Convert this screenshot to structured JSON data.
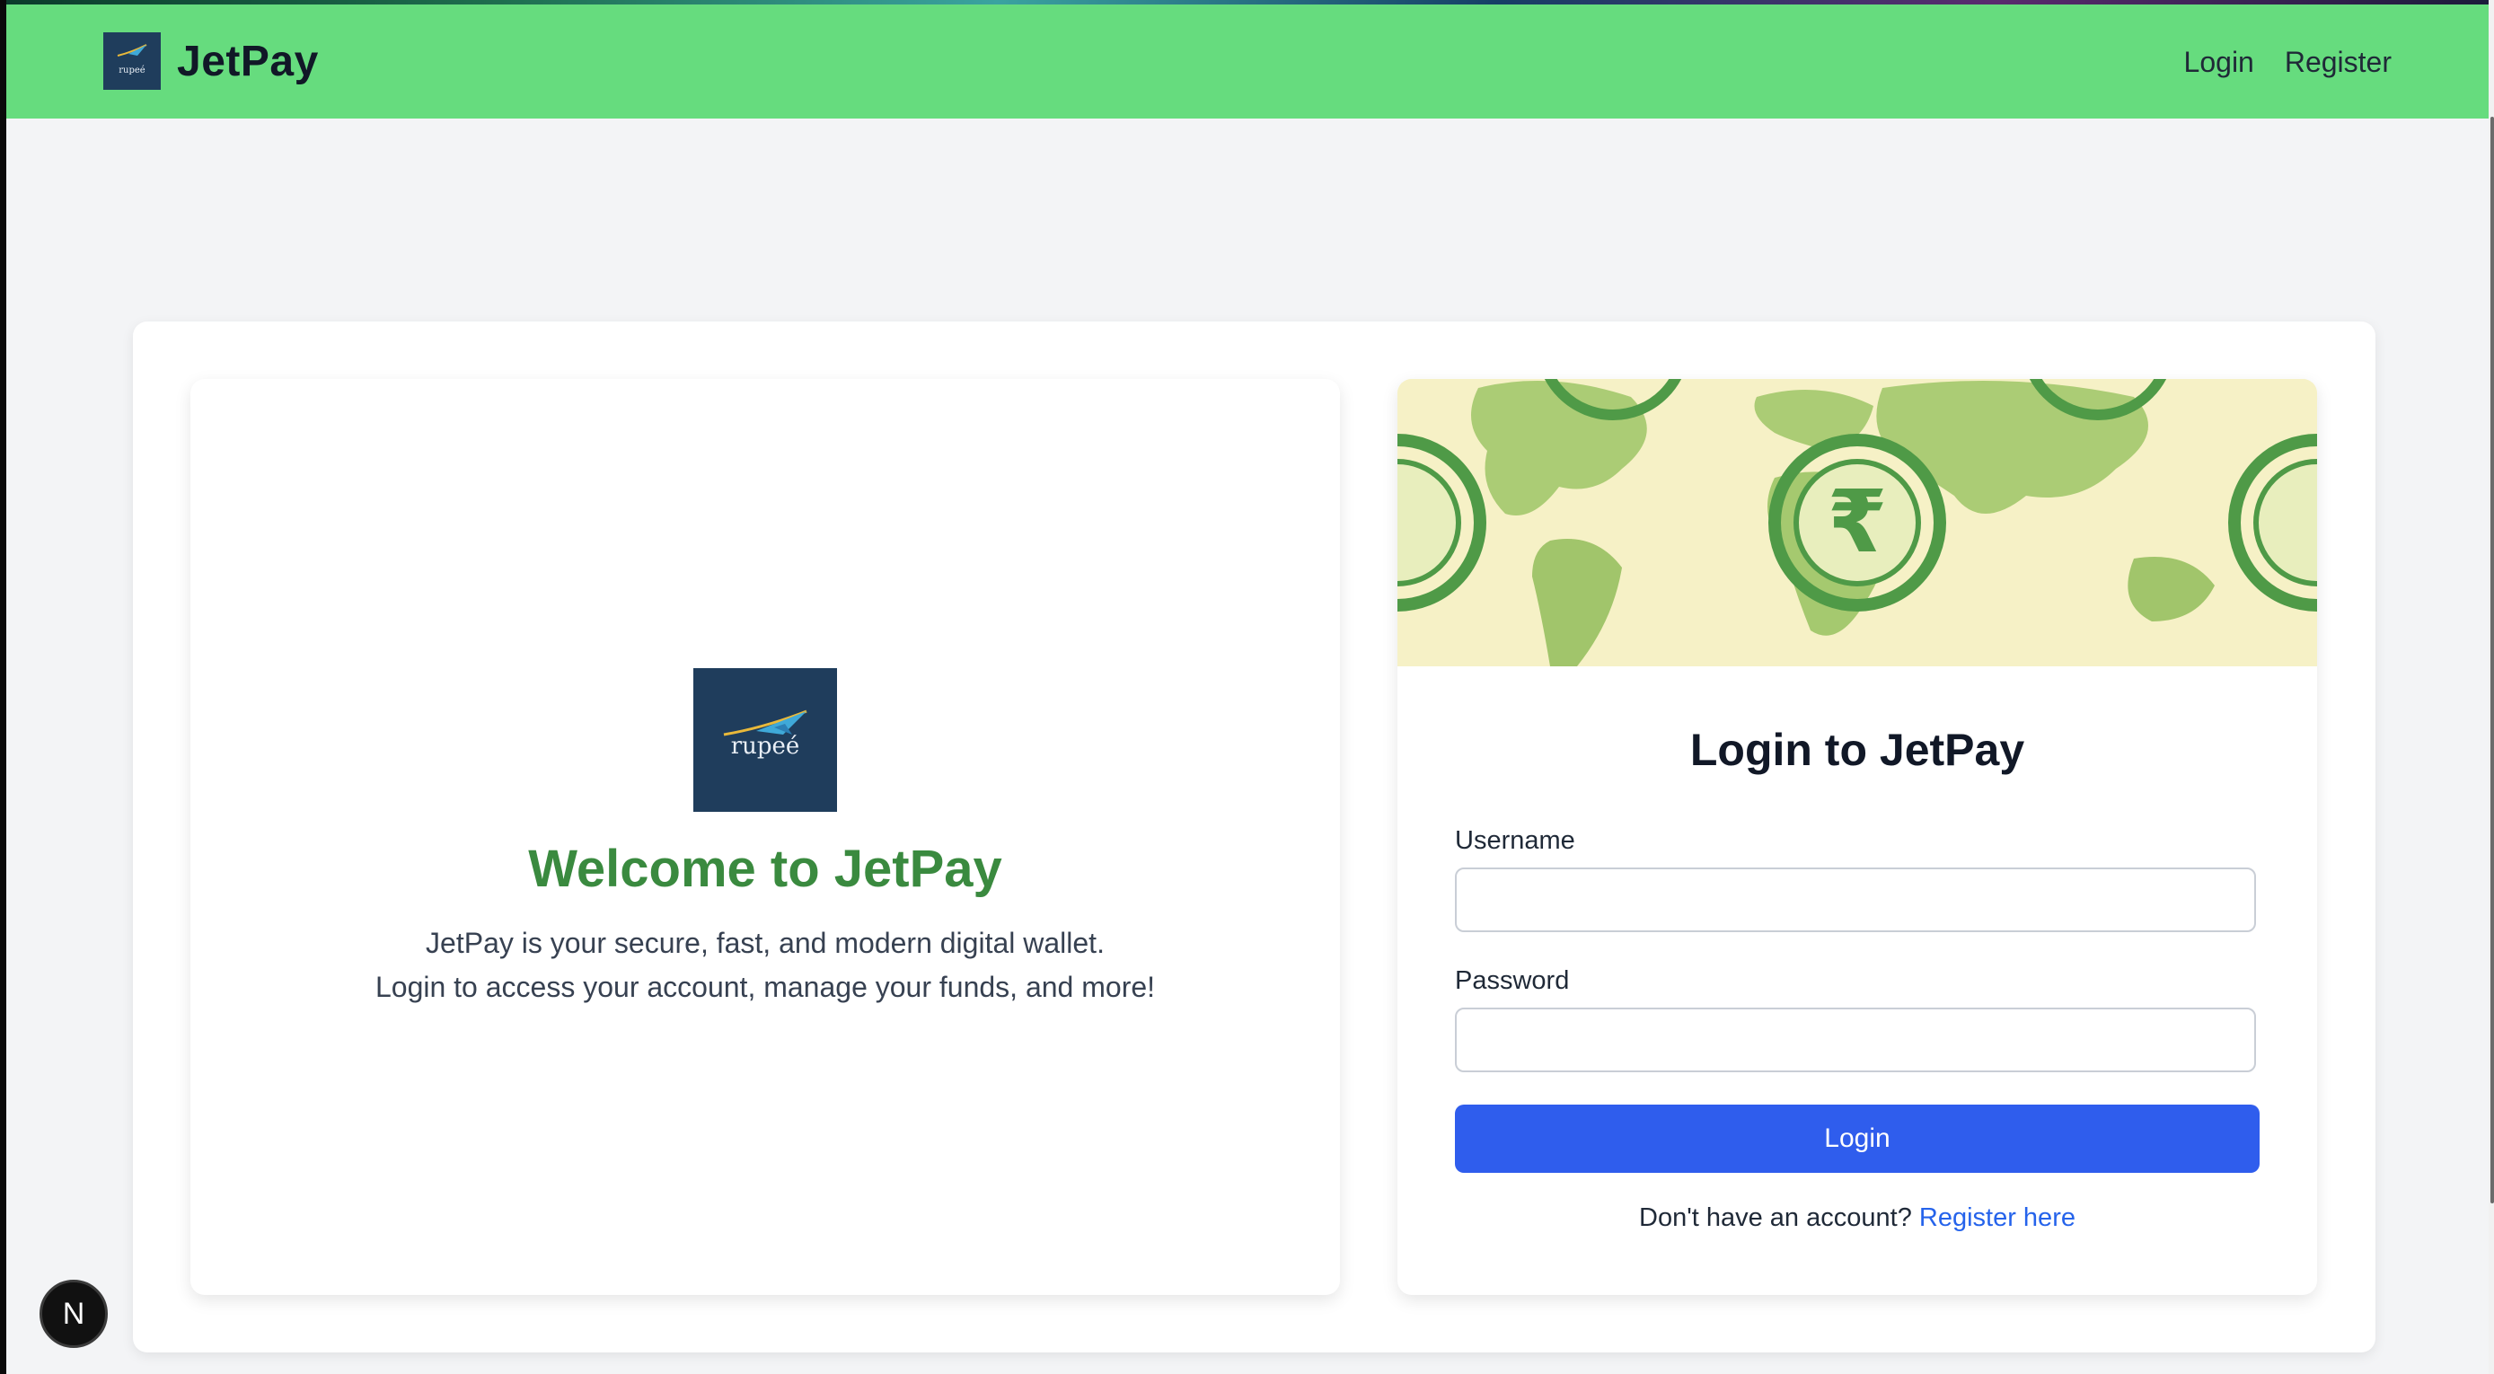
{
  "nav": {
    "brand_name": "JetPay",
    "logo_text": "rupeé",
    "links": [
      "Login",
      "Register"
    ]
  },
  "welcome": {
    "logo_text": "rupeé",
    "title": "Welcome to JetPay",
    "line1": "JetPay is your secure, fast, and modern digital wallet.",
    "line2": "Login to access your account, manage your funds, and more!"
  },
  "login": {
    "hero_symbol": "₹",
    "title": "Login to JetPay",
    "username_label": "Username",
    "username_value": "",
    "password_label": "Password",
    "password_value": "",
    "button_label": "Login",
    "register_prompt": "Don't have an account?",
    "register_link": "Register here"
  },
  "dev_badge": {
    "label": "N"
  },
  "colors": {
    "navbar": "#66dc7e",
    "welcome_title": "#3a8a3f",
    "primary_button": "#2f5ded",
    "link": "#2563eb",
    "logo_bg": "#1f3d5c",
    "hero_bg": "#f6f1c6",
    "hero_green": "#4f9a47"
  },
  "icons": {
    "brand_logo": "jet-rupee-logo",
    "hero": "world-map-rupee-illustration",
    "dev_badge": "nextjs-icon"
  }
}
